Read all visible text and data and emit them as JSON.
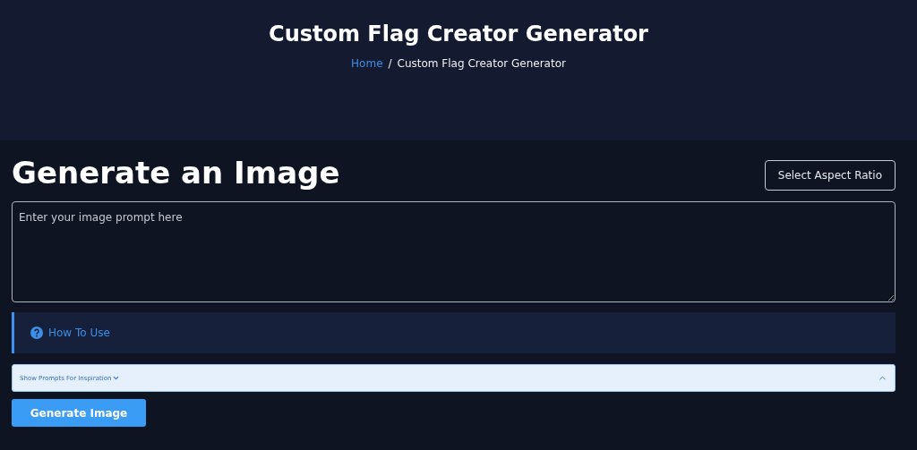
{
  "header": {
    "title": "Custom Flag Creator Generator",
    "breadcrumb_separator": "/",
    "breadcrumb": [
      {
        "label": "Home",
        "link": true
      },
      {
        "label": "Custom Flag Creator Generator",
        "link": false
      }
    ]
  },
  "generator": {
    "heading": "Generate an Image",
    "aspect_button": "Select Aspect Ratio",
    "prompt": {
      "placeholder": "Enter your image prompt here"
    },
    "how_to_use": "How To Use",
    "inspiration": "Show Prompts For Inspiration",
    "generate_button": "Generate Image"
  }
}
